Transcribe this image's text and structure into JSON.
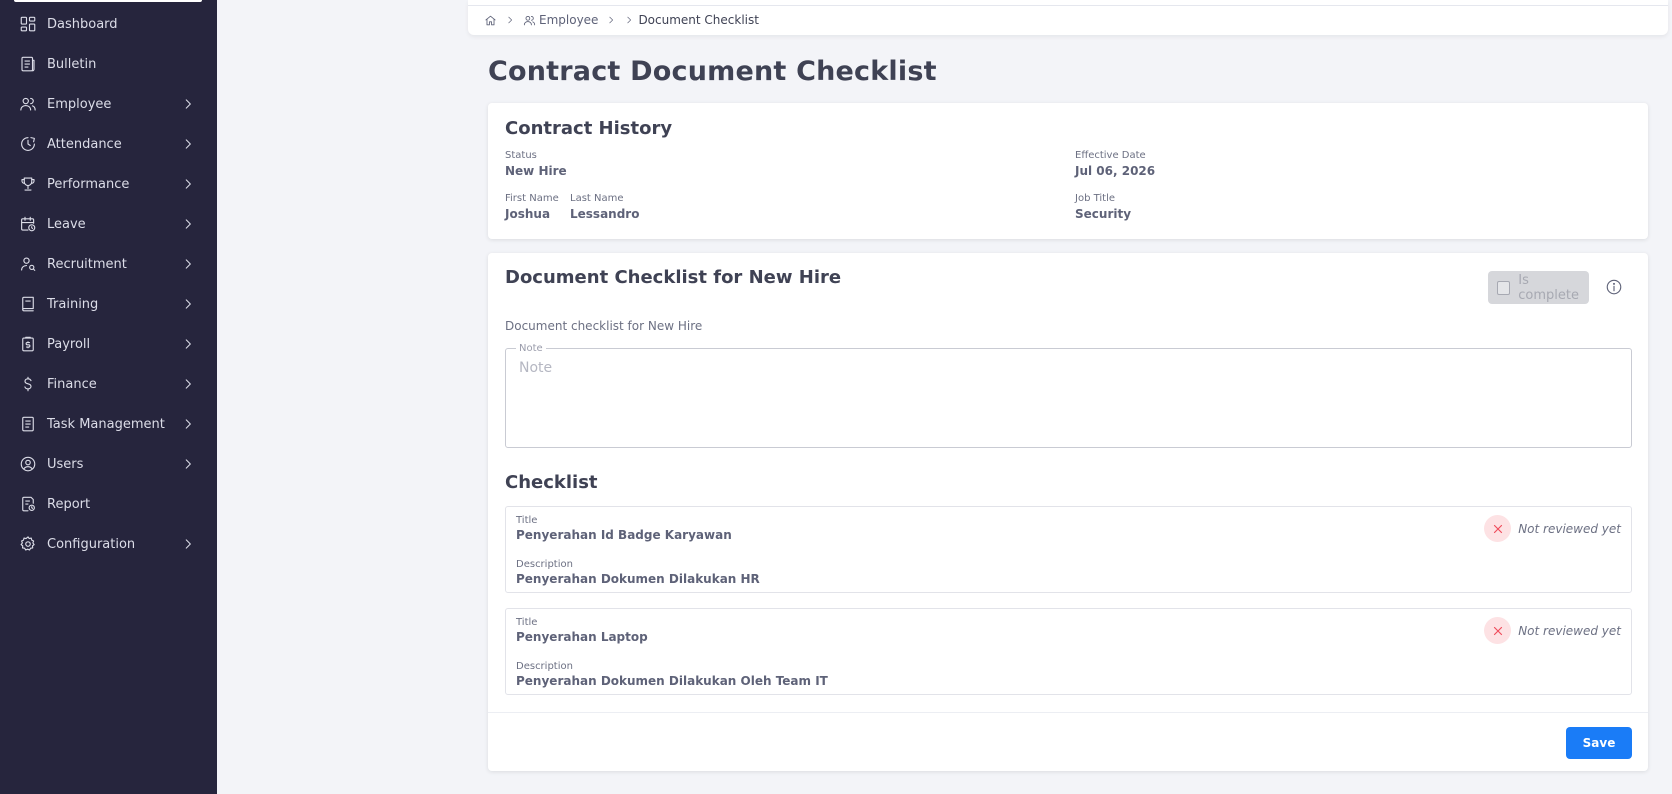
{
  "sidebar": {
    "items": [
      {
        "label": "Dashboard",
        "icon": "dashboard-icon",
        "has_children": false
      },
      {
        "label": "Bulletin",
        "icon": "bulletin-icon",
        "has_children": false
      },
      {
        "label": "Employee",
        "icon": "users-icon",
        "has_children": true
      },
      {
        "label": "Attendance",
        "icon": "clock-icon",
        "has_children": true
      },
      {
        "label": "Performance",
        "icon": "trophy-icon",
        "has_children": true
      },
      {
        "label": "Leave",
        "icon": "calendar-clock-icon",
        "has_children": true
      },
      {
        "label": "Recruitment",
        "icon": "user-search-icon",
        "has_children": true
      },
      {
        "label": "Training",
        "icon": "book-icon",
        "has_children": true
      },
      {
        "label": "Payroll",
        "icon": "clipboard-dollar-icon",
        "has_children": true
      },
      {
        "label": "Finance",
        "icon": "dollar-icon",
        "has_children": true
      },
      {
        "label": "Task Management",
        "icon": "task-list-icon",
        "has_children": true
      },
      {
        "label": "Users",
        "icon": "user-circle-icon",
        "has_children": true
      },
      {
        "label": "Report",
        "icon": "report-icon",
        "has_children": false
      },
      {
        "label": "Configuration",
        "icon": "gear-icon",
        "has_children": true
      }
    ]
  },
  "breadcrumb": {
    "home_icon": "home-icon",
    "employee": "Employee",
    "current": "Document Checklist"
  },
  "page": {
    "title": "Contract Document Checklist"
  },
  "contract_history": {
    "title": "Contract History",
    "status_label": "Status",
    "status_value": "New Hire",
    "effective_date_label": "Effective Date",
    "effective_date_value": "Jul 06, 2026",
    "first_name_label": "First Name",
    "first_name_value": "Joshua",
    "last_name_label": "Last Name",
    "last_name_value": "Lessandro",
    "job_title_label": "Job Title",
    "job_title_value": "Security"
  },
  "checklist_card": {
    "title": "Document Checklist for New Hire",
    "is_complete_label": "Is complete",
    "is_complete_checked": false,
    "subtitle": "Document checklist for New Hire",
    "note_label": "Note",
    "note_placeholder": "Note",
    "note_value": "",
    "checklist_heading": "Checklist",
    "items": [
      {
        "title_label": "Title",
        "title": "Penyerahan Id Badge Karyawan",
        "description_label": "Description",
        "description": "Penyerahan Dokumen Dilakukan HR",
        "status": "Not reviewed yet"
      },
      {
        "title_label": "Title",
        "title": "Penyerahan Laptop",
        "description_label": "Description",
        "description": "Penyerahan Dokumen Dilakukan Oleh Team IT",
        "status": "Not reviewed yet"
      }
    ],
    "save_label": "Save"
  },
  "colors": {
    "sidebar_bg": "#26253d",
    "page_bg": "#f3f4f8",
    "primary": "#1a7cf7",
    "danger": "#ef4c5c",
    "danger_bg": "#fde2e4"
  }
}
